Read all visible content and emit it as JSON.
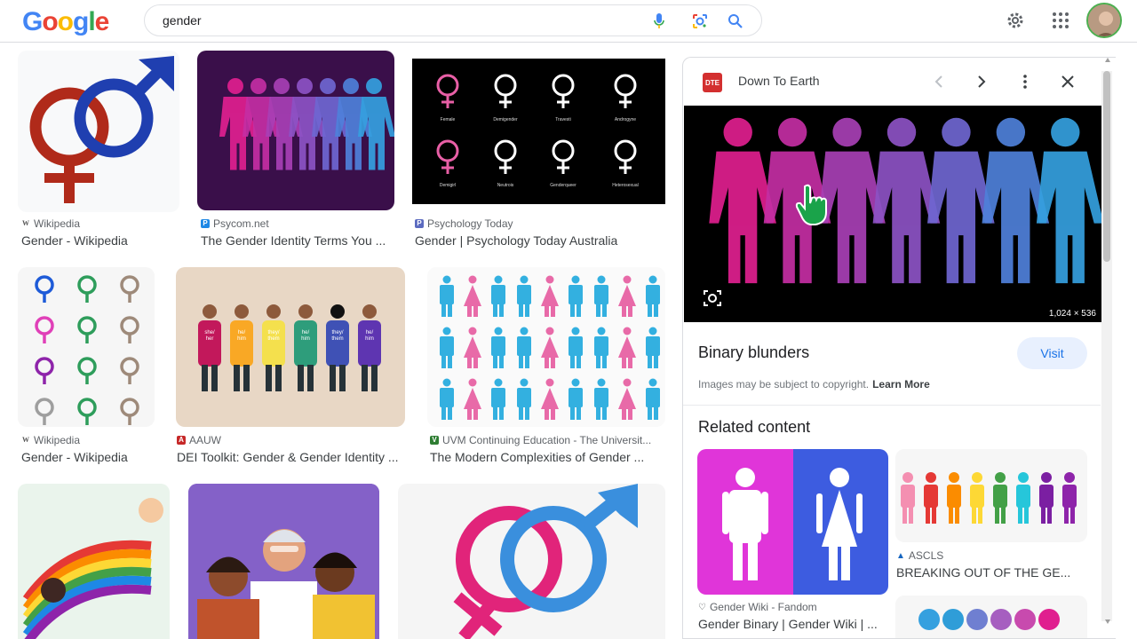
{
  "search": {
    "query": "gender"
  },
  "header": {
    "logo": [
      "G",
      "o",
      "o",
      "g",
      "l",
      "e"
    ],
    "logo_colors": [
      "#4285F4",
      "#EA4335",
      "#FBBC05",
      "#4285F4",
      "#34A853",
      "#EA4335"
    ]
  },
  "results": [
    {
      "source": "Wikipedia",
      "title": "Gender - Wikipedia"
    },
    {
      "source": "Psycom.net",
      "title": "The Gender Identity Terms You ..."
    },
    {
      "source": "Psychology Today",
      "title": "Gender | Psychology Today Australia"
    },
    {
      "source": "Wikipedia",
      "title": "Gender - Wikipedia"
    },
    {
      "source": "AAUW",
      "title": "DEI Toolkit: Gender & Gender Identity ..."
    },
    {
      "source": "UVM Continuing Education - The Universit...",
      "title": "The Modern Complexities of Gender ..."
    }
  ],
  "thumb_text": {
    "symbols": [
      "Female",
      "Demigender",
      "Travesti",
      "Androgyne",
      "Demigirl",
      "Neutrois",
      "Genderqueer",
      "Heterosexual"
    ],
    "shirts": [
      "she/\nher",
      "he/\nhim",
      "they/\nthem",
      "he/\nhim",
      "they/\nthem",
      "he/\nhim"
    ]
  },
  "panel": {
    "source": "Down To Earth",
    "logo_text": "DTE",
    "dimensions": "1,024 × 536",
    "title": "Binary blunders",
    "visit_label": "Visit",
    "copyright": "Images may be subject to copyright.",
    "learn_more": "Learn More",
    "related_heading": "Related content",
    "related": [
      {
        "source": "Gender Wiki - Fandom",
        "title": "Gender Binary | Gender Wiki | ..."
      },
      {
        "source": "ASCLS",
        "title": "BREAKING OUT OF THE GE..."
      }
    ]
  },
  "colors": {
    "pink": "#e91e8c",
    "blue": "#3aa6dd",
    "accent": "#1a73e8"
  }
}
